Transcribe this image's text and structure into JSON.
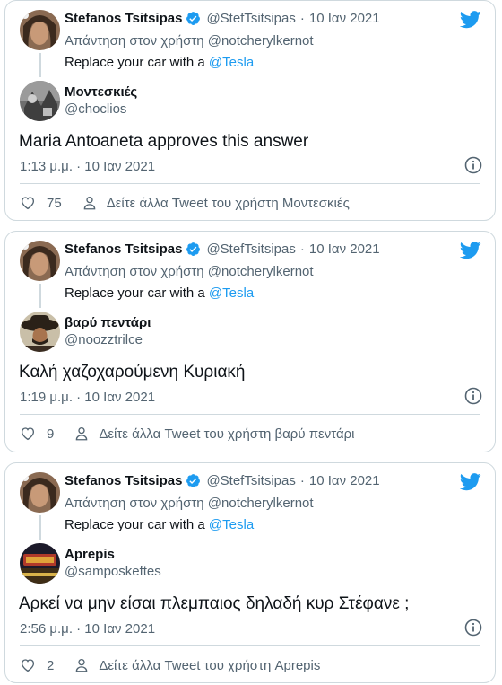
{
  "accent": "#1d9bf0",
  "cards": [
    {
      "author_name": "Stefanos Tsitsipas",
      "author_handle": "@StefTsitsipas",
      "author_date": "10 Ιαν 2021",
      "reply_to_prefix": "Απάντηση στον χρήστη",
      "reply_to_handle": "@notcherylkernot",
      "parent_text": "Replace your car with a",
      "parent_mention": "@Tesla",
      "reply_author_name": "Μοντεσκιές",
      "reply_author_handle": "@choclios",
      "reply_text": "Maria Antoaneta approves this answer",
      "reply_timestamp": "1:13 μ.μ. · 10 Ιαν 2021",
      "likes": "75",
      "view_more": "Δείτε άλλα Tweet του χρήστη Μοντεσκιές"
    },
    {
      "author_name": "Stefanos Tsitsipas",
      "author_handle": "@StefTsitsipas",
      "author_date": "10 Ιαν 2021",
      "reply_to_prefix": "Απάντηση στον χρήστη",
      "reply_to_handle": "@notcherylkernot",
      "parent_text": "Replace your car with a",
      "parent_mention": "@Tesla",
      "reply_author_name": "βαρύ πεντάρι",
      "reply_author_handle": "@noozztrilce",
      "reply_text": "Καλή χαζοχαρούμενη Κυριακή",
      "reply_timestamp": "1:19 μ.μ. · 10 Ιαν 2021",
      "likes": "9",
      "view_more": "Δείτε άλλα Tweet του χρήστη βαρύ πεντάρι"
    },
    {
      "author_name": "Stefanos Tsitsipas",
      "author_handle": "@StefTsitsipas",
      "author_date": "10 Ιαν 2021",
      "reply_to_prefix": "Απάντηση στον χρήστη",
      "reply_to_handle": "@notcherylkernot",
      "parent_text": "Replace your car with a",
      "parent_mention": "@Tesla",
      "reply_author_name": "Aprepis",
      "reply_author_handle": "@samposkeftes",
      "reply_text": "Αρκεί να μην είσαι πλεμπαιος δηλαδή κυρ Στέφανε ;",
      "reply_timestamp": "2:56 μ.μ. · 10 Ιαν 2021",
      "likes": "2",
      "view_more": "Δείτε άλλα Tweet του χρήστη Aprepis"
    }
  ]
}
